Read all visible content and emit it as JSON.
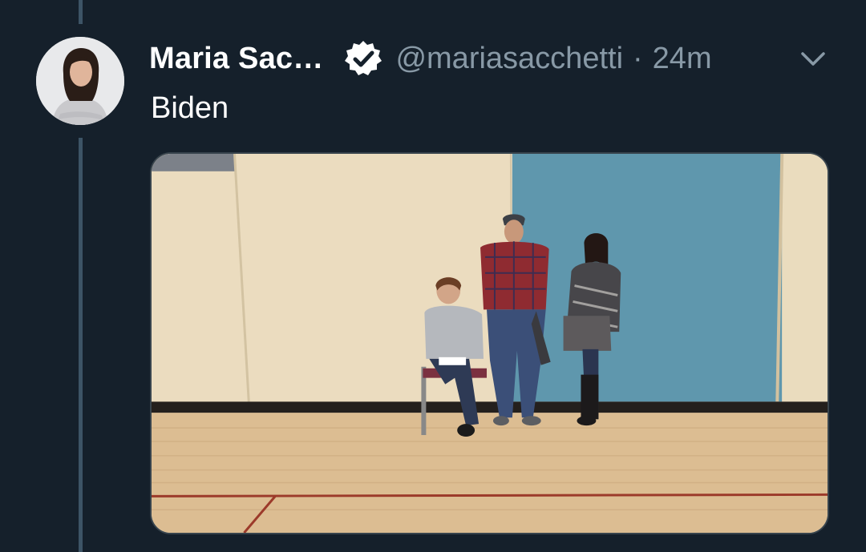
{
  "tweet": {
    "display_name": "Maria Sac…",
    "handle": "@mariasacchetti",
    "separator": "·",
    "time": "24m",
    "text": "Biden",
    "verified": true
  },
  "icons": {
    "verified": "verified-badge-icon",
    "menu": "chevron-down-icon"
  },
  "colors": {
    "background": "#15202b",
    "thread_line": "#3d5466",
    "secondary_text": "#8899a6",
    "primary_text": "#ffffff"
  }
}
